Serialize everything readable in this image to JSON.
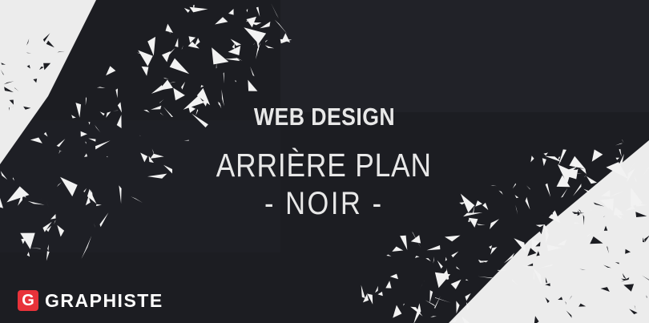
{
  "headline": {
    "line1": "WEB DESIGN",
    "line2": "ARRIÈRE PLAN",
    "line3": "- NOIR -"
  },
  "brand": {
    "badge_letter": "G",
    "name": "GRAPHISTE",
    "badge_color": "#e8323a"
  },
  "colors": {
    "background": "#1c1d22",
    "light_area": "#ececec",
    "text": "#e8e8e8"
  }
}
